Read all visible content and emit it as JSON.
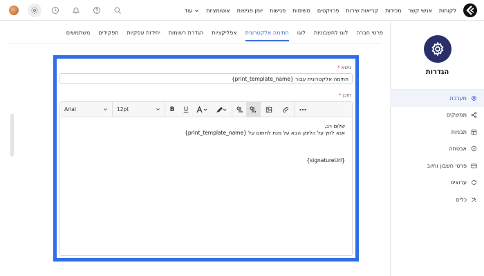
{
  "topnav": {
    "items": [
      "לקוחות",
      "אנשי קשר",
      "מכירות",
      "קריאות שירות",
      "פרויקטים",
      "משימות",
      "פגישות",
      "יומן פגישות",
      "אוטומציות"
    ],
    "more_label": "עוד"
  },
  "sidebar": {
    "title": "הגדרות",
    "items": [
      {
        "label": "מערכת",
        "icon": "gear-icon",
        "active": true
      },
      {
        "label": "ממשקים",
        "icon": "share-icon",
        "active": false
      },
      {
        "label": "תבניות",
        "icon": "layout-icon",
        "active": false
      },
      {
        "label": "אבטחה",
        "icon": "shield-icon",
        "active": false
      },
      {
        "label": "פרטי חשבון וחיוב",
        "icon": "credit-card-icon",
        "active": false
      },
      {
        "label": "ערוצים",
        "icon": "refresh-icon",
        "active": false
      },
      {
        "label": "כלים",
        "icon": "tools-icon",
        "active": false
      }
    ]
  },
  "tabs": [
    {
      "label": "פרטי חברה",
      "active": false
    },
    {
      "label": "לוגו לחשבוניות",
      "active": false
    },
    {
      "label": "לוגו",
      "active": false
    },
    {
      "label": "חתימה אלקטרונית",
      "active": true
    },
    {
      "label": "אפליקציות",
      "active": false
    },
    {
      "label": "הגדרת רשומות",
      "active": false
    },
    {
      "label": "יחידות עסקיות",
      "active": false
    },
    {
      "label": "תפקידים",
      "active": false
    },
    {
      "label": "משתמשים",
      "active": false
    }
  ],
  "form": {
    "subject_label": "נושא",
    "subject_value": "חתימה אלקטרונית עבור {print_template_name}",
    "content_label": "תוכן",
    "required_mark": "*"
  },
  "editor": {
    "font": "Arial",
    "size": "12pt",
    "body_lines": [
      "שלום רב,",
      "אנא לחץ על הלינק הבא על מנת לחתום על {print_template_name}",
      "",
      "",
      "",
      "{signatureUrl}"
    ]
  },
  "colors": {
    "accent": "#2f6ee8",
    "badge": "#2a2f6b",
    "sidebar_active": "#3a57c9"
  }
}
